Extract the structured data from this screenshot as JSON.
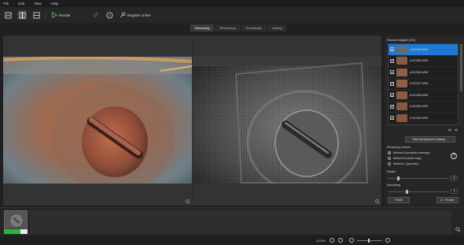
{
  "menu": [
    "File",
    "Edit",
    "View",
    "Help"
  ],
  "toolbar": {
    "render_label": "Render",
    "register_label": "Register online"
  },
  "tabs": [
    {
      "label": "Rendering",
      "active": true
    },
    {
      "label": "Retouching",
      "active": false
    },
    {
      "label": "Post/Studio",
      "active": false
    },
    {
      "label": "Saving",
      "active": false
    }
  ],
  "source_images": {
    "title": "Source images (XX)",
    "items": [
      {
        "name": "A13C2519.ARW",
        "checked": true,
        "selected": true
      },
      {
        "name": "A13C2520.ARW",
        "checked": true,
        "selected": false
      },
      {
        "name": "A13C2526.ARW",
        "checked": true,
        "selected": false
      },
      {
        "name": "A13C2527.ARW",
        "checked": true,
        "selected": false
      },
      {
        "name": "A13C2528.ARW",
        "checked": true,
        "selected": false
      },
      {
        "name": "A13C2529.ARW",
        "checked": true,
        "selected": false
      },
      {
        "name": "A13C2530.ARW",
        "checked": true,
        "selected": false
      }
    ]
  },
  "raw_button": "Raw development settings...",
  "rendering_method": {
    "title": "Rendering method",
    "options": [
      {
        "label": "Method A (weighted average)",
        "selected": true
      },
      {
        "label": "Method B (depth map)",
        "selected": false
      },
      {
        "label": "Method C (pyramid)",
        "selected": false
      }
    ]
  },
  "radius": {
    "label": "Radius",
    "value": "8"
  },
  "smoothing": {
    "label": "Smoothing",
    "value": "4"
  },
  "buttons": {
    "reset": "Reset",
    "render": "Render"
  },
  "status": {
    "zoom": "13.0%"
  },
  "colors": {
    "accent": "#1e78d6",
    "progress": "#2fb33a",
    "render_icon": "#3ec23e"
  }
}
